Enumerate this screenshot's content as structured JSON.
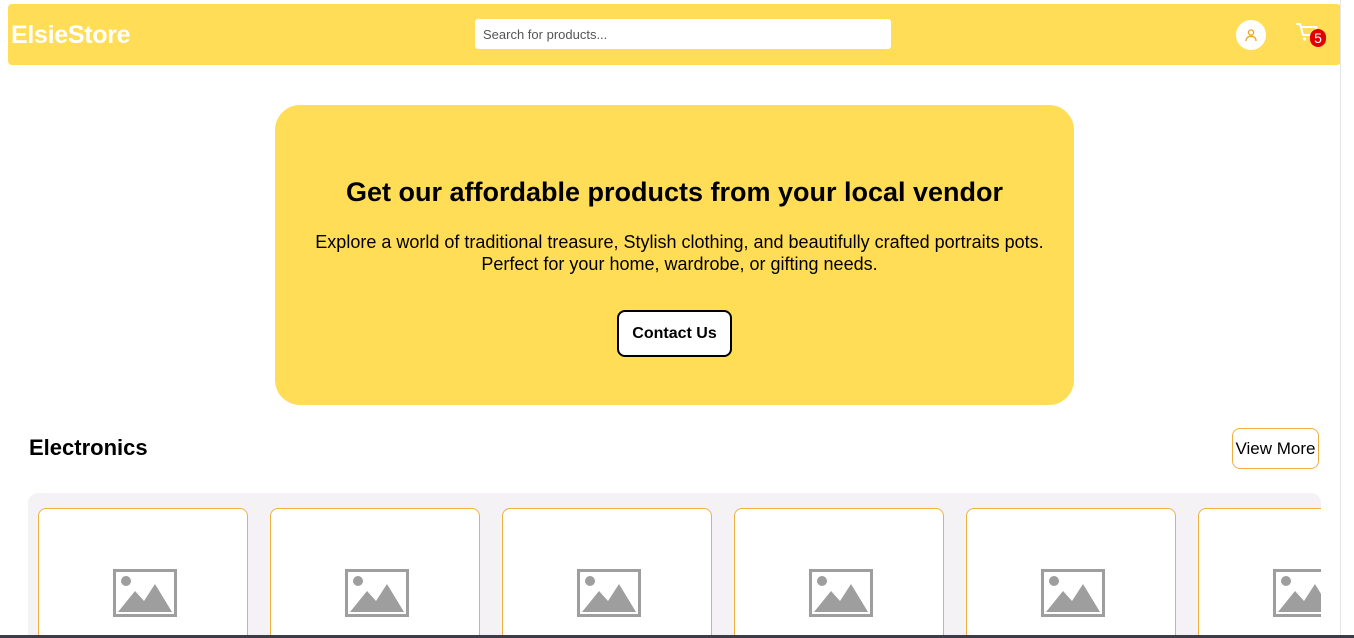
{
  "header": {
    "logo": "ElsieStore",
    "search_placeholder": "Search for products...",
    "cart_count": "5",
    "user_icon": "user-icon",
    "cart_icon": "cart-icon"
  },
  "hero": {
    "title": "Get our affordable products from your local vendor",
    "subtitle_line1": "Explore a world of traditional treasure, Stylish clothing, and beautifully crafted portraits pots.",
    "subtitle_line2": "Perfect for your home, wardrobe, or gifting needs.",
    "cta_label": "Contact Us"
  },
  "section": {
    "title": "Electronics",
    "view_more_label": "View More",
    "product_image_icon": "image-placeholder-icon"
  },
  "colors": {
    "brand_yellow": "#ffdd57",
    "card_border": "#f0b040",
    "badge_red": "#e00000"
  }
}
